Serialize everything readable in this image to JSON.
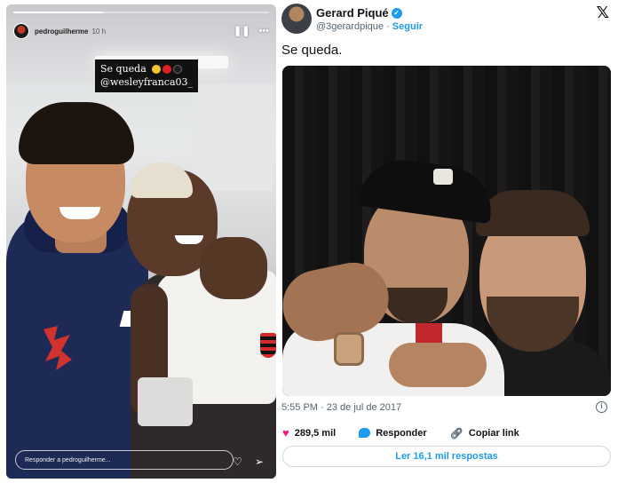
{
  "story": {
    "progress": 0.35,
    "username": "pedroguilherme",
    "time": "10 h",
    "caption_line1": "Se queda",
    "caption_line2": "@wesleyfranca03_",
    "reply_placeholder": "Responder a pedroguilherme...",
    "icons": [
      "pause-icon",
      "more-icon",
      "heart-icon",
      "send-icon"
    ]
  },
  "tweet": {
    "name": "Gerard Piqué",
    "handle": "@3gerardpique",
    "separator": "·",
    "follow_label": "Seguir",
    "text": "Se queda.",
    "timestamp": "5:55 PM · 23 de jul de 2017",
    "likes": "289,5 mil",
    "reply_label": "Responder",
    "copy_link_label": "Copiar link",
    "read_replies_label": "Ler 16,1 mil respostas",
    "colors": {
      "accent": "#1d9bf0",
      "like": "#f91880"
    }
  }
}
